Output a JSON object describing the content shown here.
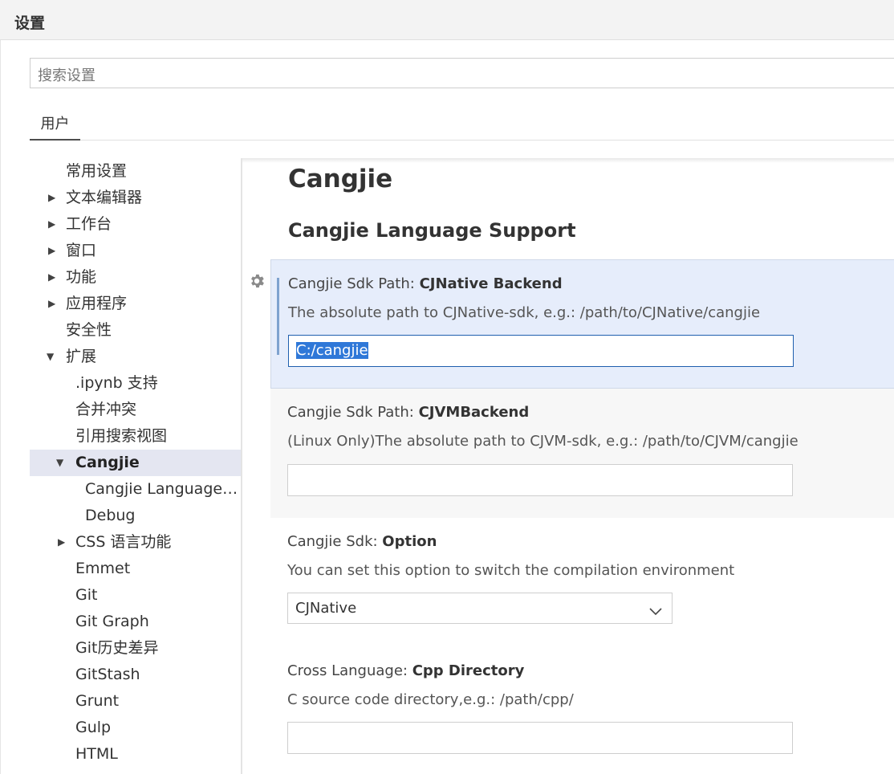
{
  "window": {
    "title": "设置"
  },
  "search": {
    "placeholder": "搜索设置"
  },
  "scope_tabs": [
    {
      "label": "用户"
    }
  ],
  "tree": {
    "items": [
      {
        "label": "常用设置",
        "twisty": ""
      },
      {
        "label": "文本编辑器",
        "twisty": "▶"
      },
      {
        "label": "工作台",
        "twisty": "▶"
      },
      {
        "label": "窗口",
        "twisty": "▶"
      },
      {
        "label": "功能",
        "twisty": "▶"
      },
      {
        "label": "应用程序",
        "twisty": "▶"
      },
      {
        "label": "安全性",
        "twisty": ""
      },
      {
        "label": "扩展",
        "twisty": "▼"
      },
      {
        "label": ".ipynb 支持",
        "twisty": ""
      },
      {
        "label": "合并冲突",
        "twisty": ""
      },
      {
        "label": "引用搜索视图",
        "twisty": ""
      },
      {
        "label": "Cangjie",
        "twisty": "▼"
      },
      {
        "label": "Cangjie Language Support",
        "twisty": ""
      },
      {
        "label": "Debug",
        "twisty": ""
      },
      {
        "label": "CSS 语言功能",
        "twisty": "▶"
      },
      {
        "label": "Emmet",
        "twisty": ""
      },
      {
        "label": "Git",
        "twisty": ""
      },
      {
        "label": "Git Graph",
        "twisty": ""
      },
      {
        "label": "Git历史差异",
        "twisty": ""
      },
      {
        "label": "GitStash",
        "twisty": ""
      },
      {
        "label": "Grunt",
        "twisty": ""
      },
      {
        "label": "Gulp",
        "twisty": ""
      },
      {
        "label": "HTML",
        "twisty": ""
      }
    ]
  },
  "content": {
    "heading": "Cangjie",
    "subheading": "Cangjie Language Support",
    "settings": [
      {
        "category": "Cangjie Sdk Path: ",
        "name": "CJNative Backend",
        "description": "The absolute path to CJNative-sdk, e.g.: /path/to/CJNative/cangjie",
        "value": "C:/cangjie"
      },
      {
        "category": "Cangjie Sdk Path: ",
        "name": "CJVMBackend",
        "description": "(Linux Only)The absolute path to CJVM-sdk, e.g.: /path/to/CJVM/cangjie",
        "value": ""
      },
      {
        "category": "Cangjie Sdk: ",
        "name": "Option",
        "description": "You can set this option to switch the compilation environment",
        "value": "CJNative"
      },
      {
        "category": "Cross Language: ",
        "name": "Cpp Directory",
        "description": "C source code directory,e.g.: /path/cpp/",
        "value": ""
      }
    ]
  },
  "icons": {
    "gear": "gear-icon",
    "dropdown": "chevron-down-icon",
    "collapsed": "chevron-right-icon",
    "expanded": "chevron-down-icon"
  },
  "colors": {
    "selected_row": "#e4e6f1",
    "focused_setting": "#e6edfb",
    "focus_bar": "#7fa3cf",
    "input_focus_border": "#1f5fae",
    "text_selection": "#2f78d8"
  }
}
